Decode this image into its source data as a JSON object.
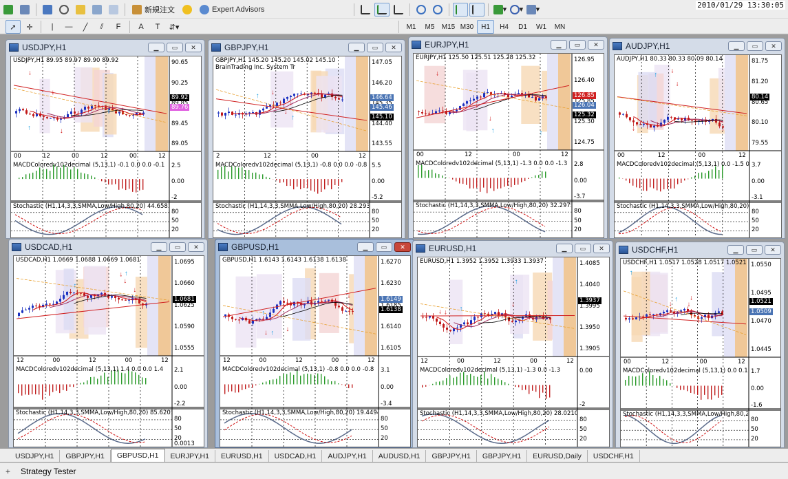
{
  "clock": "2010/01/29 13:30:05",
  "toolbar": {
    "new_order_label": "新規注文",
    "expert_advisors_label": "Expert Advisors",
    "timeframes": [
      "M1",
      "M5",
      "M15",
      "M30",
      "H1",
      "H4",
      "D1",
      "W1",
      "MN"
    ],
    "active_timeframe": "H1"
  },
  "windows": [
    {
      "title": "USDJPY,H1",
      "header": "USDJPY,H1  89.95 89.97 89.90 89.92",
      "prices": [
        "90.65",
        "90.25",
        "89.85",
        "89.45",
        "89.05"
      ],
      "tags": [
        {
          "text": "89.92",
          "color": "#000000"
        },
        {
          "text": "89.76",
          "color": "#e060e0"
        }
      ],
      "times": [
        "00",
        "12",
        "00",
        "12",
        "00",
        "12"
      ],
      "macd": "MACDColoredv102decimal (5,13,1) -0.1 0.0 0.0 -0.1",
      "macd_scale": [
        "2.5",
        "0.00",
        "-2"
      ],
      "stoch": "Stochastic (H1,14,3,3,SMMA,Low/High,80,20) 44.6583 55.2764",
      "stoch_scale": [
        "80",
        "50",
        "20"
      ]
    },
    {
      "title": "GBPJPY,H1",
      "header": "GBPJPY,H1  145.20 145.20 145.02 145.10",
      "subheader": "BrainTrading Inc. System Tr",
      "prices": [
        "147.05",
        "146.20",
        "145.35",
        "144.40",
        "143.55"
      ],
      "tags": [
        {
          "text": "146.64",
          "color": "#4a74b4"
        },
        {
          "text": "145.46",
          "color": "#4a74b4"
        },
        {
          "text": "145.10",
          "color": "#000000"
        }
      ],
      "times": [
        "2",
        "12",
        "00",
        "12"
      ],
      "macd": "MACDColoredv102decimal (5,13,1) -0.8 0.0 0.0 -0.8",
      "macd_scale": [
        "5.5",
        "0.00",
        "-5.2"
      ],
      "stoch": "Stochastic (H1,14,3,3,SMMA,Low/High,80,20) 28.2934 35.387",
      "stoch_scale": [
        "80",
        "50",
        "20"
      ]
    },
    {
      "title": "EURJPY,H1",
      "header": "EURJPY,H1  125.50 125.51 125.28 125.32",
      "prices": [
        "126.95",
        "126.40",
        "125.85",
        "125.30",
        "124.75"
      ],
      "tags": [
        {
          "text": "126.85",
          "color": "#d02020"
        },
        {
          "text": "126.04",
          "color": "#4a74b4"
        },
        {
          "text": "125.32",
          "color": "#000000"
        }
      ],
      "times": [
        "00",
        "12",
        "00",
        "12"
      ],
      "macd": "MACDColoredv102decimal (5,13,1) -1.3 0.0 0.0 -1.3",
      "macd_scale": [
        "2.8",
        "0.00",
        "-3.7"
      ],
      "stoch": "Stochastic (H1,14,3,3,SMMA,Low/High,80,20) 32.2975 41.995",
      "stoch_scale": [
        "80",
        "50",
        "20"
      ]
    },
    {
      "title": "AUDJPY,H1",
      "header": "AUDJPY,H1  80.33 80.33 80.09 80.14",
      "prices": [
        "81.75",
        "81.20",
        "80.65",
        "80.10",
        "79.55"
      ],
      "tags": [
        {
          "text": "80.14",
          "color": "#000000"
        }
      ],
      "times": [
        "00",
        "12",
        "00",
        "12"
      ],
      "macd": "MACDColoredv102decimal (5,13,1) 0.0 -1.5 0.0 -1.5",
      "macd_scale": [
        "3.7",
        "0.00",
        "-3.1"
      ],
      "stoch": "Stochastic (H1,14,3,3,SMMA,Low/High,80,20) 29.61",
      "stoch_scale": [
        "80",
        "50",
        "20"
      ]
    },
    {
      "title": "USDCAD,H1",
      "header": "USDCAD,H1  1.0669 1.0688 1.0669 1.0681",
      "prices": [
        "1.0695",
        "1.0660",
        "1.0625",
        "1.0590",
        "1.0555"
      ],
      "tags": [
        {
          "text": "1.0681",
          "color": "#000000"
        }
      ],
      "times": [
        "12",
        "00",
        "12",
        "00",
        "12"
      ],
      "macd": "MACDColoredv102decimal (5,13,1) 1.4 0.0 0.0 1.4",
      "macd_scale": [
        "2.1",
        "0.00",
        "-2.2"
      ],
      "stoch": "Stochastic (H1,14,3,3,SMMA,Low/High,80,20) 85.6205 82.3171",
      "stoch_scale": [
        "80",
        "50",
        "20"
      ],
      "footer": "0.0013"
    },
    {
      "title": "GBPUSD,H1",
      "header": "GBPUSD,H1  1.6143 1.6143 1.6138 1.6138",
      "prices": [
        "1.6270",
        "1.6230",
        "1.6185",
        "1.6140",
        "1.6105"
      ],
      "tags": [
        {
          "text": "1.6149",
          "color": "#4a74b4"
        },
        {
          "text": "1.6138",
          "color": "#000000"
        }
      ],
      "times": [
        "12",
        "00",
        "12",
        "00",
        "12"
      ],
      "macd": "MACDColoredv102decimal (5,13,1) -0.8 0.0 0.0 -0.8",
      "macd_scale": [
        "3.1",
        "0.00",
        "-3.4"
      ],
      "stoch": "Stochastic (H1,14,3,3,SMMA,Low/High,80,20) 19.4494 22.4691",
      "stoch_scale": [
        "80",
        "50",
        "20"
      ]
    },
    {
      "title": "EURUSD,H1",
      "header": "EURUSD,H1  1.3952 1.3952 1.3933 1.3937",
      "prices": [
        "1.4085",
        "1.4040",
        "1.3995",
        "1.3950",
        "1.3905"
      ],
      "tags": [
        {
          "text": "1.3937",
          "color": "#000000"
        }
      ],
      "times": [
        "12",
        "00",
        "12",
        "00",
        "12"
      ],
      "macd": "MACDColoredv102decimal (5,13,1) -1.3 0.0 -1.3",
      "macd_scale": [
        "0.00",
        "-2"
      ],
      "stoch": "Stochastic (H1,14,3,3,SMMA,Low/High,80,20) 28.0210 35.6877",
      "stoch_scale": [
        "80",
        "50",
        "20"
      ]
    },
    {
      "title": "USDCHF,H1",
      "header": "USDCHF,H1  1.0517 1.0528 1.0517 1.0521",
      "prices": [
        "1.0550",
        "1.0495",
        "1.0470",
        "1.0445"
      ],
      "tags": [
        {
          "text": "1.0521",
          "color": "#000000"
        },
        {
          "text": "1.0509",
          "color": "#4a74b4"
        }
      ],
      "times": [
        "00",
        "12",
        "00",
        "12"
      ],
      "macd": "MACDColoredv102decimal (5,13,1) 0.0 0.1 0.0 0.1",
      "macd_scale": [
        "1.7",
        "0.00",
        "-1.6"
      ],
      "stoch": "Stochastic (H1,14,3,3,SMMA,Low/High,80,20) 46.1",
      "stoch_scale": [
        "80",
        "50",
        "20"
      ]
    }
  ],
  "tabs": [
    "USDJPY,H1",
    "GBPJPY,H1",
    "GBPUSD,H1",
    "EURJPY,H1",
    "EURUSD,H1",
    "USDCAD,H1",
    "AUDJPY,H1",
    "AUDUSD,H1",
    "GBPJPY,H1",
    "GBPJPY,H1",
    "EURUSD,Daily",
    "USDCHF,H1"
  ],
  "active_tab": "GBPUSD,H1",
  "status": {
    "strategy_tester_label": "Strategy Tester"
  }
}
